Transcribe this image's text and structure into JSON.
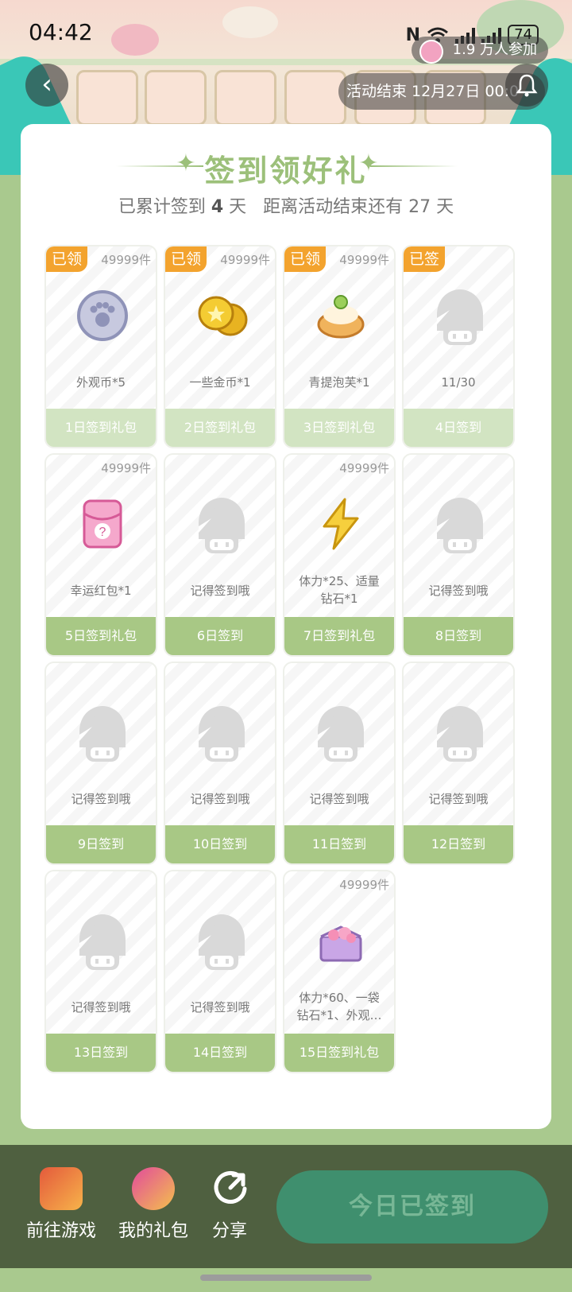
{
  "status_bar": {
    "time": "04:42",
    "battery": "74"
  },
  "header": {
    "participants": "1.9 万人参加",
    "activity_end": "活动结束 12月27日 00:0"
  },
  "card": {
    "title": "签到领好礼",
    "subtitle_prefix": "已累计签到",
    "signed_days": "4",
    "subtitle_mid": "天",
    "subtitle_remaining_prefix": "距离活动结束还有",
    "remaining_days": "27",
    "subtitle_suffix": "天"
  },
  "gifts": [
    {
      "badge": "已领",
      "stock": "49999件",
      "name": "外观币*5",
      "footer": "1日签到礼包",
      "icon": "paw-coin-icon"
    },
    {
      "badge": "已领",
      "stock": "49999件",
      "name": "一些金币*1",
      "footer": "2日签到礼包",
      "icon": "gold-coins-icon"
    },
    {
      "badge": "已领",
      "stock": "49999件",
      "name": "青提泡芙*1",
      "footer": "3日签到礼包",
      "icon": "cream-puff-icon"
    },
    {
      "badge": "已签",
      "stock": "",
      "name": "11/30",
      "footer": "4日签到",
      "icon": "placeholder-character-icon"
    },
    {
      "badge": "",
      "stock": "49999件",
      "name": "幸运红包*1",
      "footer": "5日签到礼包",
      "icon": "lucky-envelope-icon"
    },
    {
      "badge": "",
      "stock": "",
      "name": "记得签到哦",
      "footer": "6日签到",
      "icon": "placeholder-character-icon"
    },
    {
      "badge": "",
      "stock": "49999件",
      "name": "体力*25、适量钻石*1",
      "footer": "7日签到礼包",
      "icon": "lightning-icon"
    },
    {
      "badge": "",
      "stock": "",
      "name": "记得签到哦",
      "footer": "8日签到",
      "icon": "placeholder-character-icon"
    },
    {
      "badge": "",
      "stock": "",
      "name": "记得签到哦",
      "footer": "9日签到",
      "icon": "placeholder-character-icon"
    },
    {
      "badge": "",
      "stock": "",
      "name": "记得签到哦",
      "footer": "10日签到",
      "icon": "placeholder-character-icon"
    },
    {
      "badge": "",
      "stock": "",
      "name": "记得签到哦",
      "footer": "11日签到",
      "icon": "placeholder-character-icon"
    },
    {
      "badge": "",
      "stock": "",
      "name": "记得签到哦",
      "footer": "12日签到",
      "icon": "placeholder-character-icon"
    },
    {
      "badge": "",
      "stock": "",
      "name": "记得签到哦",
      "footer": "13日签到",
      "icon": "placeholder-character-icon"
    },
    {
      "badge": "",
      "stock": "",
      "name": "记得签到哦",
      "footer": "14日签到",
      "icon": "placeholder-character-icon"
    },
    {
      "badge": "",
      "stock": "49999件",
      "name": "体力*60、一袋钻石*1、外观…",
      "footer": "15日签到礼包",
      "icon": "gift-box-icon"
    }
  ],
  "bottom_bar": {
    "go_game": "前往游戏",
    "my_gifts": "我的礼包",
    "share": "分享",
    "checked_in": "今日已签到"
  },
  "colors": {
    "accent_green": "#9cc07a",
    "badge_orange": "#f3a32e",
    "bottom_bg": "#4f6040",
    "button_teal": "#3f8f6e"
  }
}
